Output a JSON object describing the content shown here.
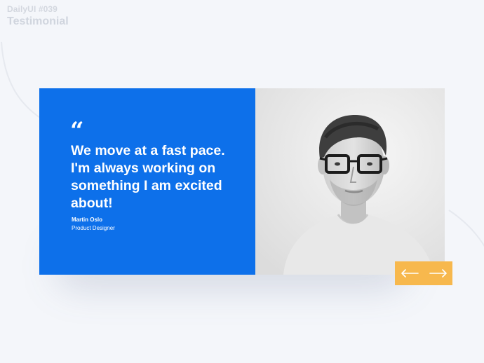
{
  "header": {
    "subtitle": "DailyUI #039",
    "title": "Testimonial"
  },
  "testimonial": {
    "quote_mark": "“",
    "quote": "We move at a fast pace. I'm always working on something I am excited about!",
    "author_name": "Martin Oslo",
    "author_role": "Product Designer",
    "photo_description": "portrait-photo"
  },
  "navigation": {
    "prev_icon": "arrow-left-icon",
    "next_icon": "arrow-right-icon"
  },
  "colors": {
    "background": "#f4f6fa",
    "primary": "#0d70ea",
    "accent": "#f7b84d",
    "text_light": "#ffffff",
    "header_text": "#d0d5de"
  }
}
